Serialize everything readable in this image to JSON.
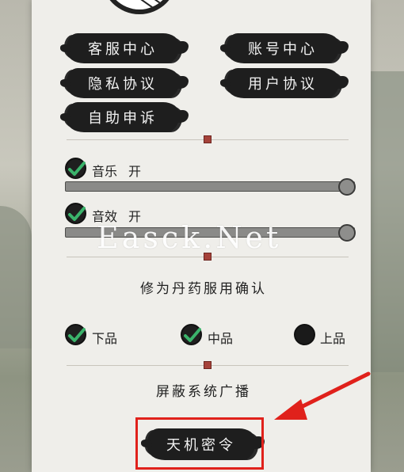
{
  "menu": {
    "customer_service": "客服中心",
    "account_center": "账号中心",
    "privacy_policy": "隐私协议",
    "user_agreement": "用户协议",
    "self_appeal": "自助申诉"
  },
  "audio": {
    "music_label": "音乐",
    "music_state": "开",
    "music_level": 1.0,
    "sfx_label": "音效",
    "sfx_state": "开",
    "sfx_level": 1.0
  },
  "pill_confirm": {
    "title": "修为丹药服用确认",
    "options": [
      {
        "label": "下品",
        "checked": true
      },
      {
        "label": "中品",
        "checked": true
      },
      {
        "label": "上品",
        "checked": false
      }
    ]
  },
  "ads": {
    "title": "屏蔽系统广播"
  },
  "secret_button": "天机密令",
  "watermark": "Easck.Net",
  "colors": {
    "check_green": "#3bb36b",
    "highlight_red": "#e0211b",
    "seal_red": "#a5423a"
  }
}
